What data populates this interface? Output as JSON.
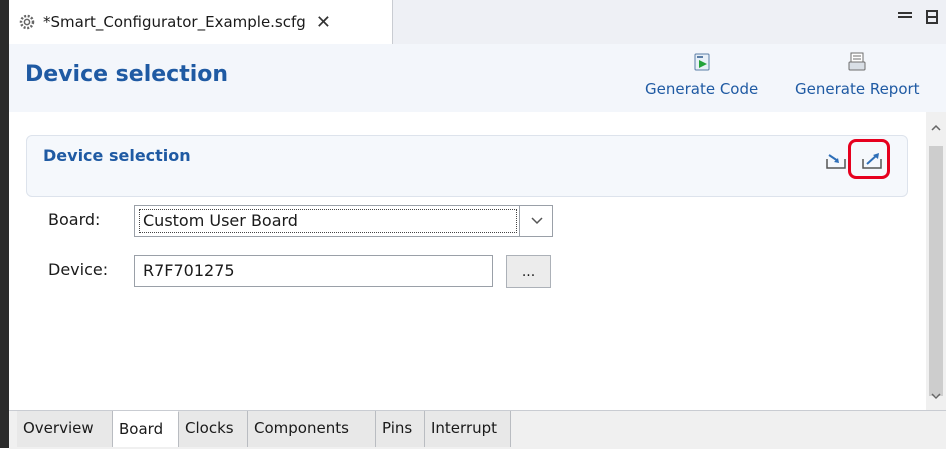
{
  "editor_tab": {
    "title": "*Smart_Configurator_Example.scfg",
    "close_label": "✕"
  },
  "page": {
    "title": "Device selection",
    "actions": [
      {
        "label": "Generate Code",
        "icon": "generate-code-icon"
      },
      {
        "label": "Generate Report",
        "icon": "generate-report-icon"
      }
    ]
  },
  "section": {
    "title": "Device selection",
    "buttons": [
      {
        "icon": "import-icon"
      },
      {
        "icon": "export-icon"
      }
    ]
  },
  "form": {
    "board_label": "Board:",
    "board_value": "Custom User Board",
    "device_label": "Device:",
    "device_value": "R7F701275",
    "browse_label": "..."
  },
  "bottom_tabs": [
    "Overview",
    "Board",
    "Clocks",
    "Components",
    "Pins",
    "Interrupt"
  ],
  "active_tab": "Board",
  "colors": {
    "accent": "#1f5aa3",
    "highlight": "#e6001e"
  }
}
